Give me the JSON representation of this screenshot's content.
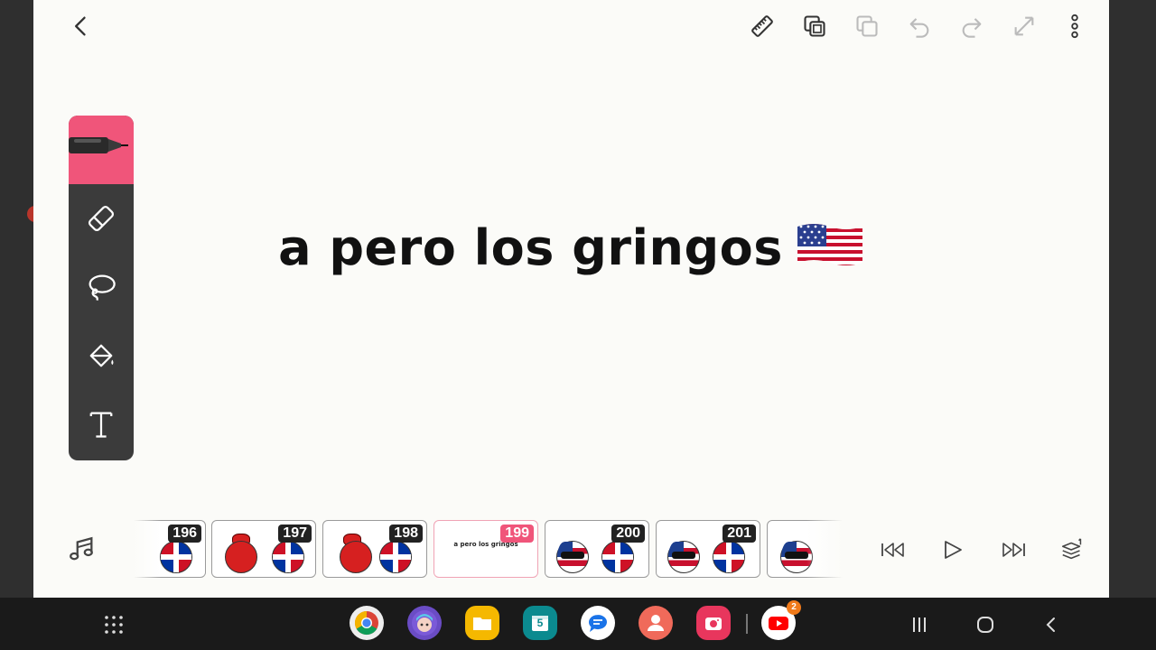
{
  "canvas": {
    "text": "a pero los gringos",
    "flag_icon": "usa-flag-emoji"
  },
  "top_toolbar": {
    "icons": [
      "ruler-icon",
      "layers-icon",
      "duplicate-icon",
      "undo-icon",
      "redo-icon",
      "fullscreen-icon",
      "more-vertical-icon"
    ]
  },
  "tools": {
    "items": [
      "pen-icon",
      "eraser-icon",
      "lasso-icon",
      "fill-bucket-icon",
      "text-tool-icon"
    ],
    "accent": "#f0557a"
  },
  "timeline": {
    "frames": [
      {
        "number": "196"
      },
      {
        "number": "197"
      },
      {
        "number": "198"
      },
      {
        "number": "199",
        "caption": "a pero los gringos"
      },
      {
        "number": "200"
      },
      {
        "number": "201"
      }
    ],
    "current_frame": "199"
  },
  "taskbar": {
    "calendar_day": "5",
    "youtube_badge": "2"
  }
}
